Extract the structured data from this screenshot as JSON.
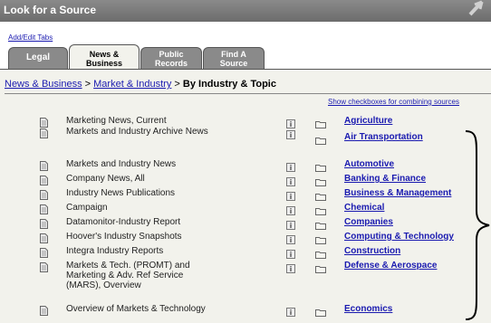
{
  "title": "Look for a Source",
  "add_edit_tabs": "Add/Edit Tabs",
  "tabs": [
    {
      "label": "Legal"
    },
    {
      "label": "News & Business"
    },
    {
      "label": "Public Records"
    },
    {
      "label": "Find A Source"
    }
  ],
  "breadcrumb": {
    "item1": "News & Business",
    "sep": " > ",
    "item2": "Market & Industry",
    "current": "By Industry & Topic"
  },
  "show_checkboxes": "Show checkboxes for combining sources",
  "sources": [
    "Marketing News, Current",
    "Markets and Industry Archive News",
    "Markets and Industry News",
    "Company News, All",
    "Industry News Publications",
    "Campaign",
    "Datamonitor-Industry Report",
    "Hoover's Industry Snapshots",
    "Integra Industry Reports",
    "Markets & Tech. (PROMT) and Marketing & Adv. Ref Service (MARS), Overview",
    "Overview of Markets & Technology"
  ],
  "topics": [
    "Agriculture",
    "Air Transportation",
    "Automotive",
    "Banking & Finance",
    "Business & Management",
    "Chemical",
    "Companies",
    "Computing & Technology",
    "Construction",
    "Defense & Aerospace",
    "Economics"
  ]
}
